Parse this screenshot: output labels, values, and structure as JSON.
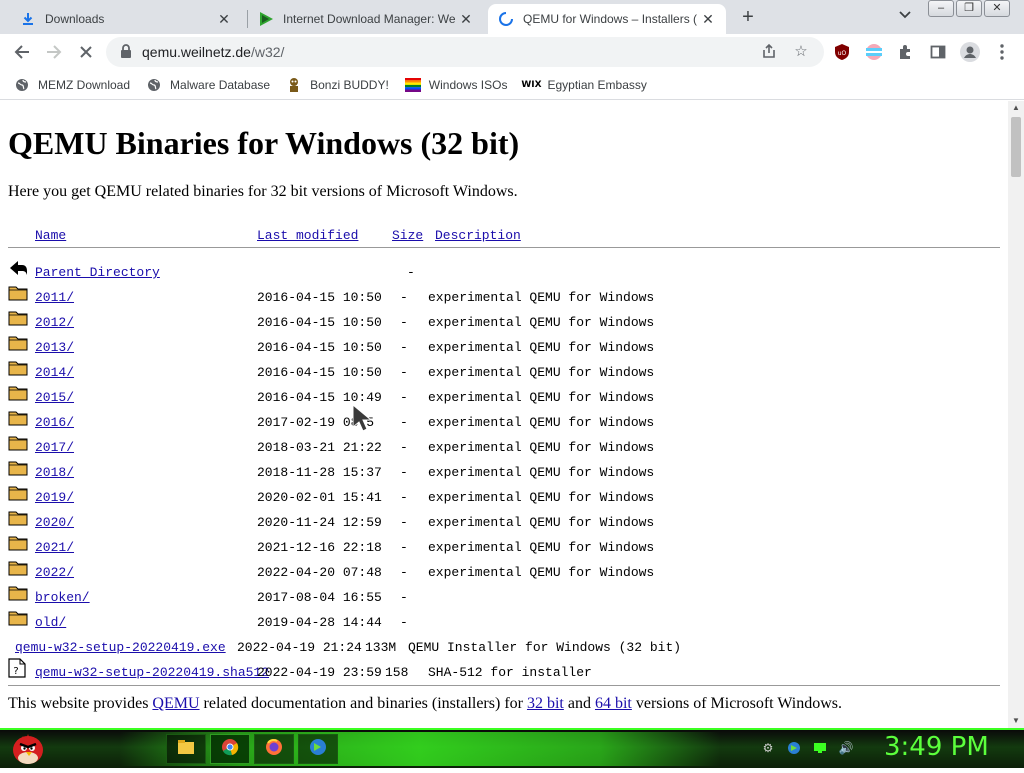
{
  "tabs": [
    {
      "title": "Downloads",
      "icon": "download-icon"
    },
    {
      "title": "Internet Download Manager: We",
      "icon": "idm-icon"
    },
    {
      "title": "QEMU for Windows – Installers (",
      "icon": "loading-spinner-icon"
    }
  ],
  "toolbar": {
    "url_host": "qemu.weilnetz.de",
    "url_path": "/w32/"
  },
  "bookmarks": [
    {
      "label": "MEMZ Download",
      "icon": "globe-icon"
    },
    {
      "label": "Malware Database",
      "icon": "globe-icon"
    },
    {
      "label": "Bonzi BUDDY!",
      "icon": "bonzi-icon"
    },
    {
      "label": "Windows ISOs",
      "icon": "rainbow-flag-icon"
    },
    {
      "label": "Egyptian Embassy",
      "icon": "wix-icon"
    }
  ],
  "page": {
    "title": "QEMU Binaries for Windows (32 bit)",
    "intro": "Here you get QEMU related binaries for 32 bit versions of Microsoft Windows.",
    "columns": {
      "name": "Name",
      "modified": "Last modified",
      "size": "Size",
      "description": "Description"
    },
    "parent": {
      "name": "Parent Directory",
      "size": "-"
    },
    "rows": [
      {
        "name": "2011/",
        "modified": "2016-04-15 10:50",
        "size": "-",
        "description": "experimental QEMU for Windows",
        "type": "folder"
      },
      {
        "name": "2012/",
        "modified": "2016-04-15 10:50",
        "size": "-",
        "description": "experimental QEMU for Windows",
        "type": "folder"
      },
      {
        "name": "2013/",
        "modified": "2016-04-15 10:50",
        "size": "-",
        "description": "experimental QEMU for Windows",
        "type": "folder"
      },
      {
        "name": "2014/",
        "modified": "2016-04-15 10:50",
        "size": "-",
        "description": "experimental QEMU for Windows",
        "type": "folder"
      },
      {
        "name": "2015/",
        "modified": "2016-04-15 10:49",
        "size": "-",
        "description": "experimental QEMU for Windows",
        "type": "folder"
      },
      {
        "name": "2016/",
        "modified": "2017-02-19 08:5",
        "size": "-",
        "description": "experimental QEMU for Windows",
        "type": "folder"
      },
      {
        "name": "2017/",
        "modified": "2018-03-21 21:22",
        "size": "-",
        "description": "experimental QEMU for Windows",
        "type": "folder"
      },
      {
        "name": "2018/",
        "modified": "2018-11-28 15:37",
        "size": "-",
        "description": "experimental QEMU for Windows",
        "type": "folder"
      },
      {
        "name": "2019/",
        "modified": "2020-02-01 15:41",
        "size": "-",
        "description": "experimental QEMU for Windows",
        "type": "folder"
      },
      {
        "name": "2020/",
        "modified": "2020-11-24 12:59",
        "size": "-",
        "description": "experimental QEMU for Windows",
        "type": "folder"
      },
      {
        "name": "2021/",
        "modified": "2021-12-16 22:18",
        "size": "-",
        "description": "experimental QEMU for Windows",
        "type": "folder"
      },
      {
        "name": "2022/",
        "modified": "2022-04-20 07:48",
        "size": "-",
        "description": "experimental QEMU for Windows",
        "type": "folder"
      },
      {
        "name": "broken/",
        "modified": "2017-08-04 16:55",
        "size": "-",
        "description": "",
        "type": "folder"
      },
      {
        "name": "old/",
        "modified": "2019-04-28 14:44",
        "size": "-",
        "description": "",
        "type": "folder"
      },
      {
        "name": "qemu-w32-setup-20220419.exe",
        "modified": "2022-04-19 21:24",
        "size": "133M",
        "description": "QEMU Installer for Windows (32 bit)",
        "type": "exe"
      },
      {
        "name": "qemu-w32-setup-20220419.sha512",
        "modified": "2022-04-19 23:59",
        "size": "158",
        "description": "SHA-512 for installer",
        "type": "text"
      }
    ],
    "footer": {
      "pre": "This website provides ",
      "link1": "QEMU",
      "mid1": " related documentation and binaries (installers) for ",
      "link2": "32 bit",
      "mid2": " and ",
      "link3": "64 bit",
      "post": " versions of Microsoft Windows."
    }
  },
  "taskbar": {
    "apps": [
      "file-explorer-icon",
      "chrome-icon",
      "firefox-icon",
      "idm-icon"
    ],
    "clock": "3:49 PM"
  },
  "colors": {
    "accent_green": "#3cff22",
    "link": "#1a0dab"
  }
}
